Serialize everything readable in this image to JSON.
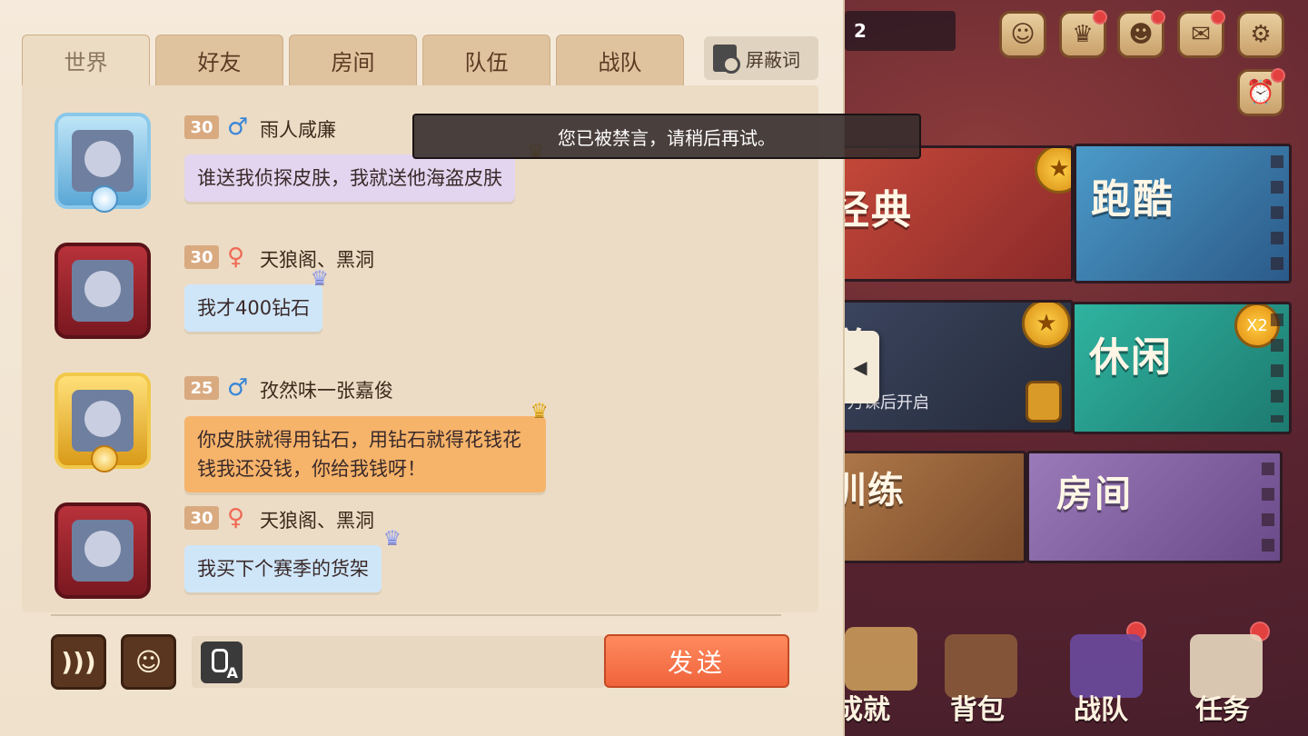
{
  "top_bar": {
    "field_value": "2"
  },
  "modes": {
    "classic": "经典",
    "parkour": "跑酷",
    "ladder": "天梯",
    "ladder_status": "万课后开启",
    "casual": "休闲",
    "casual_multiplier": "X2",
    "training": "训练",
    "room": "房间"
  },
  "bottom_nav": {
    "achievement": "成就",
    "bag": "背包",
    "team": "战队",
    "tasks": "任务"
  },
  "chat": {
    "tabs": [
      "世界",
      "好友",
      "房间",
      "队伍",
      "战队"
    ],
    "block_words_label": "屏蔽词",
    "toast": "您已被禁言，请稍后再试。",
    "messages": [
      {
        "level": "30",
        "gender": "male",
        "gender_symbol": "♂",
        "name": "雨人咸廉",
        "text": "谁送我侦探皮肤，我就送他海盗皮肤",
        "bubble_color": "#e3d4ef"
      },
      {
        "level": "30",
        "gender": "female",
        "gender_symbol": "♀",
        "name": "天狼阁、黑洞",
        "text": "我才400钻石",
        "bubble_color": "#cfe6f9"
      },
      {
        "level": "25",
        "gender": "male",
        "gender_symbol": "♂",
        "name": "孜然味一张嘉俊",
        "text": "你皮肤就得用钻石，用钻石就得花钱花钱我还没钱，你给我钱呀！",
        "bubble_color": "#f6b36a"
      },
      {
        "level": "30",
        "gender": "female",
        "gender_symbol": "♀",
        "name": "天狼阁、黑洞",
        "text": "我买下个赛季的货架",
        "bubble_color": "#cfe6f9"
      }
    ],
    "input": {
      "value": "",
      "placeholder": ""
    },
    "voice_to_text_label": "A",
    "send_label": "发送"
  }
}
